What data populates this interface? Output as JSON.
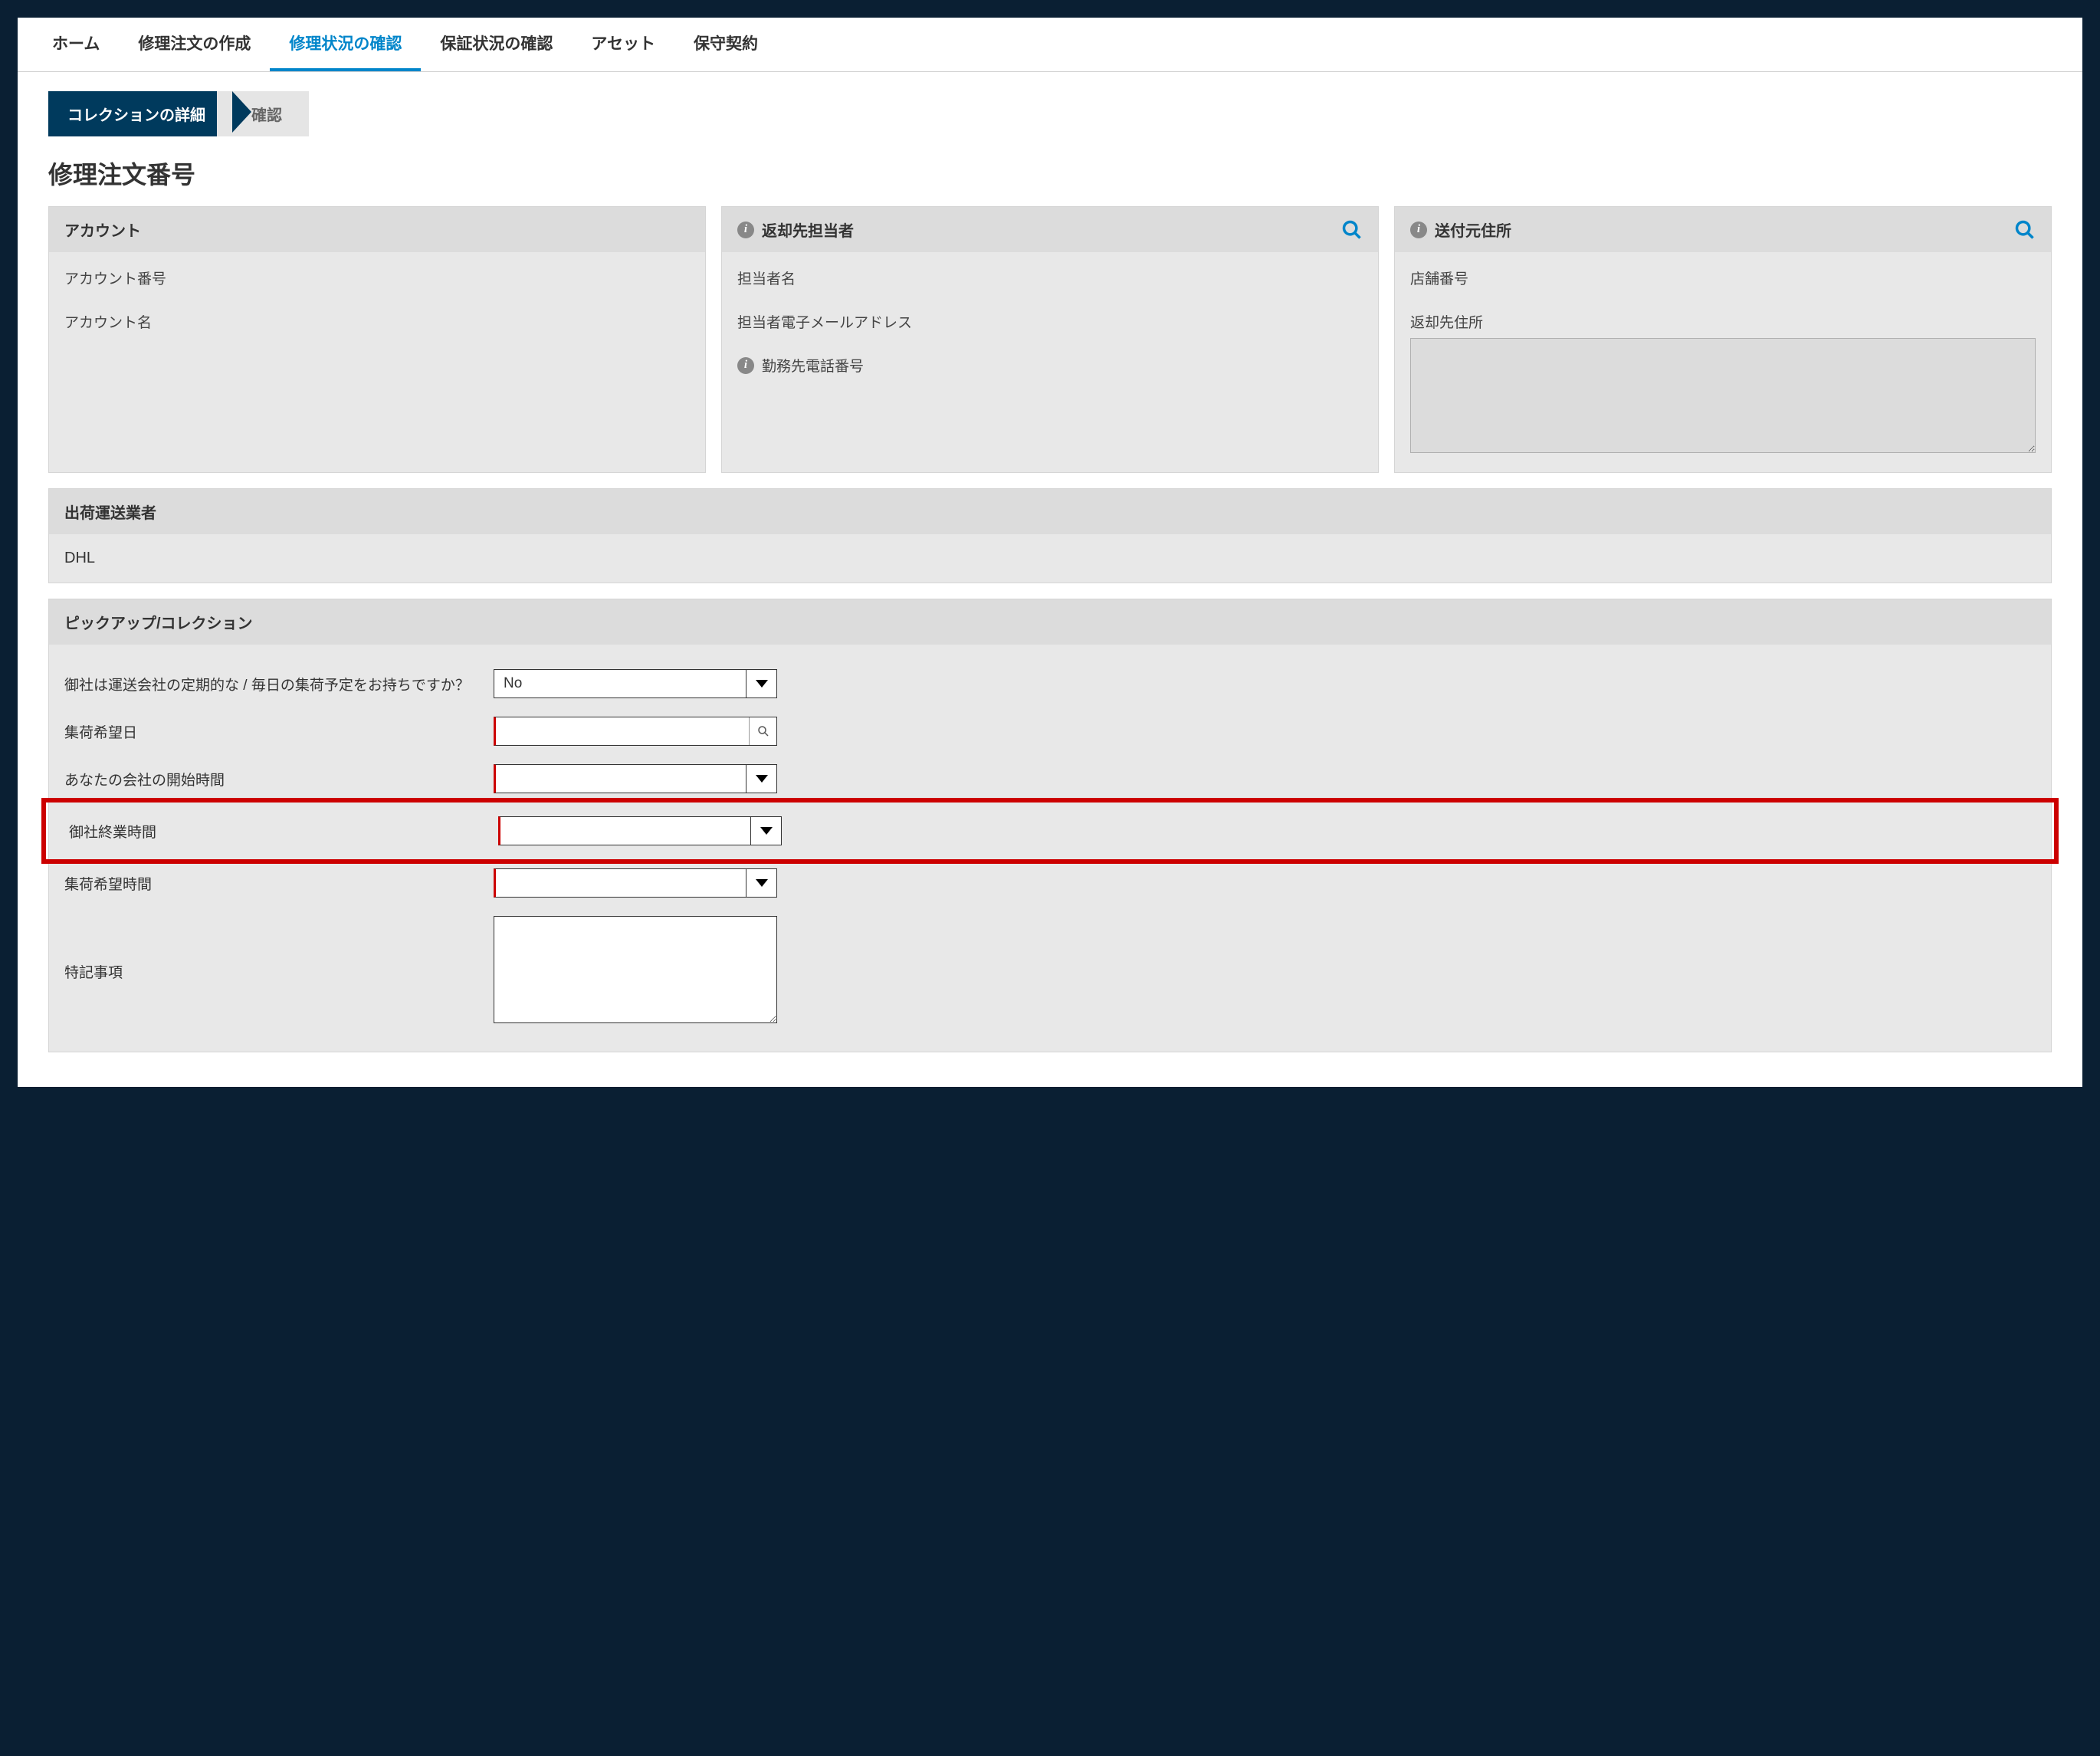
{
  "tabs": {
    "home": "ホーム",
    "create_repair": "修理注文の作成",
    "check_repair": "修理状況の確認",
    "check_warranty": "保証状況の確認",
    "asset": "アセット",
    "maintenance": "保守契約"
  },
  "breadcrumb": {
    "step1": "コレクションの詳細",
    "step2": "確認"
  },
  "page_title": "修理注文番号",
  "cards": {
    "account": {
      "title": "アカウント",
      "account_number_label": "アカウント番号",
      "account_name_label": "アカウント名"
    },
    "return_contact": {
      "title": "返却先担当者",
      "contact_name_label": "担当者名",
      "contact_email_label": "担当者電子メールアドレス",
      "work_phone_label": "勤務先電話番号"
    },
    "ship_from": {
      "title": "送付元住所",
      "store_number_label": "店舗番号",
      "return_address_label": "返却先住所"
    }
  },
  "carrier_section": {
    "title": "出荷運送業者",
    "value": "DHL"
  },
  "pickup_section": {
    "title": "ピックアップ/コレクション",
    "scheduled_pickup_label": "御社は運送会社の定期的な / 毎日の集荷予定をお持ちですか？",
    "scheduled_pickup_value": "No",
    "preferred_date_label": "集荷希望日",
    "open_time_label": "あなたの会社の開始時間",
    "close_time_label": "御社終業時間",
    "preferred_time_label": "集荷希望時間",
    "special_notes_label": "特記事項"
  }
}
